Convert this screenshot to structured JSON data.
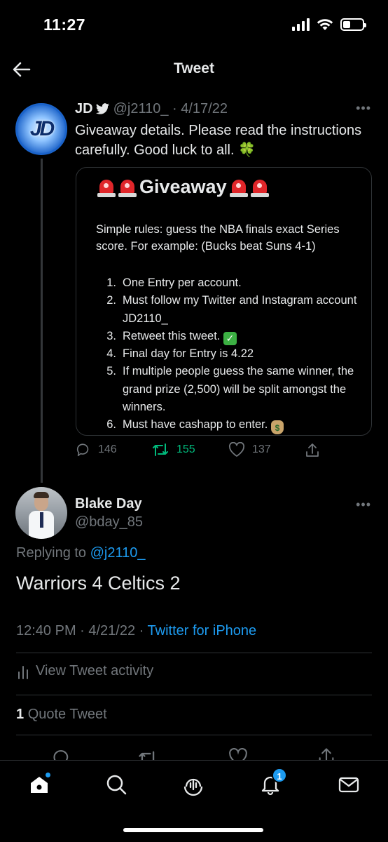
{
  "status_bar": {
    "time": "11:27"
  },
  "header": {
    "title": "Tweet"
  },
  "quoted_tweet": {
    "author_name": "JD",
    "avatar_text": "JD",
    "handle": "@j2110_",
    "date": "· 4/17/22",
    "text": "Giveaway details.  Please read the instructions carefully. Good luck to all. 🍀",
    "card": {
      "title": "Giveaway",
      "rules": "Simple rules: guess the NBA finals exact Series score.  For example: (Bucks beat Suns 4-1)",
      "items": [
        {
          "num": "1.",
          "text": "One Entry per account."
        },
        {
          "num": "2.",
          "text": "Must follow my Twitter and Instagram account JD2110_"
        },
        {
          "num": "3.",
          "text": "Retweet this tweet."
        },
        {
          "num": "4.",
          "text": "Final day for Entry is 4.22"
        },
        {
          "num": "5.",
          "text": "If multiple people guess the same winner, the grand prize (2,500) will be split amongst the winners."
        },
        {
          "num": "6.",
          "text": "Must have cashapp to enter."
        }
      ]
    },
    "stats": {
      "replies": "146",
      "retweets": "155",
      "likes": "137"
    }
  },
  "reply": {
    "author_name": "Blake Day",
    "handle": "@bday_85",
    "replying_prefix": "Replying to",
    "replying_to": "@j2110_",
    "text": "Warriors 4 Celtics 2",
    "time": "12:40 PM · 4/21/22 ·",
    "source": "Twitter for iPhone",
    "activity_label": "View Tweet activity",
    "quote_count": "1",
    "quote_label": "Quote Tweet"
  },
  "tabbar": {
    "notifications_count": "1"
  },
  "colors": {
    "accent": "#1d9bf0",
    "retweet_green": "#00ba7c",
    "muted": "#71767b",
    "background": "#000000"
  }
}
